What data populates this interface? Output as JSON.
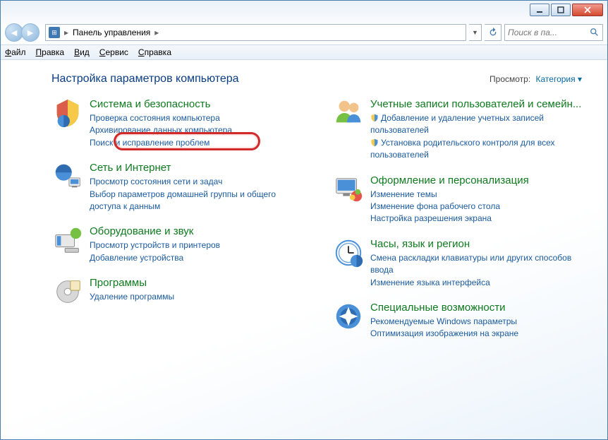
{
  "breadcrumb": {
    "root": "Панель управления"
  },
  "search": {
    "placeholder": "Поиск в па..."
  },
  "menu": {
    "file": "Файл",
    "edit": "Правка",
    "view": "Вид",
    "tools": "Сервис",
    "help": "Справка"
  },
  "heading": "Настройка параметров компьютера",
  "view_label": "Просмотр:",
  "view_value": "Категория",
  "left": [
    {
      "title": "Система и безопасность",
      "links": [
        {
          "t": "Проверка состояния компьютера"
        },
        {
          "t": "Архивирование данных компьютера"
        },
        {
          "t": "Поиск и исправление проблем"
        }
      ]
    },
    {
      "title": "Сеть и Интернет",
      "links": [
        {
          "t": "Просмотр состояния сети и задач"
        },
        {
          "t": "Выбор параметров домашней группы и общего доступа к данным"
        }
      ]
    },
    {
      "title": "Оборудование и звук",
      "links": [
        {
          "t": "Просмотр устройств и принтеров"
        },
        {
          "t": "Добавление устройства"
        }
      ]
    },
    {
      "title": "Программы",
      "links": [
        {
          "t": "Удаление программы"
        }
      ]
    }
  ],
  "right": [
    {
      "title": "Учетные записи пользователей и семейн...",
      "links": [
        {
          "t": "Добавление и удаление учетных записей пользователей",
          "shield": true
        },
        {
          "t": "Установка родительского контроля для всех пользователей",
          "shield": true
        }
      ]
    },
    {
      "title": "Оформление и персонализация",
      "links": [
        {
          "t": "Изменение темы"
        },
        {
          "t": "Изменение фона рабочего стола"
        },
        {
          "t": "Настройка разрешения экрана"
        }
      ]
    },
    {
      "title": "Часы, язык и регион",
      "links": [
        {
          "t": "Смена раскладки клавиатуры или других способов ввода"
        },
        {
          "t": "Изменение языка интерфейса"
        }
      ]
    },
    {
      "title": "Специальные возможности",
      "links": [
        {
          "t": "Рекомендуемые Windows параметры"
        },
        {
          "t": "Оптимизация изображения на экране"
        }
      ]
    }
  ]
}
